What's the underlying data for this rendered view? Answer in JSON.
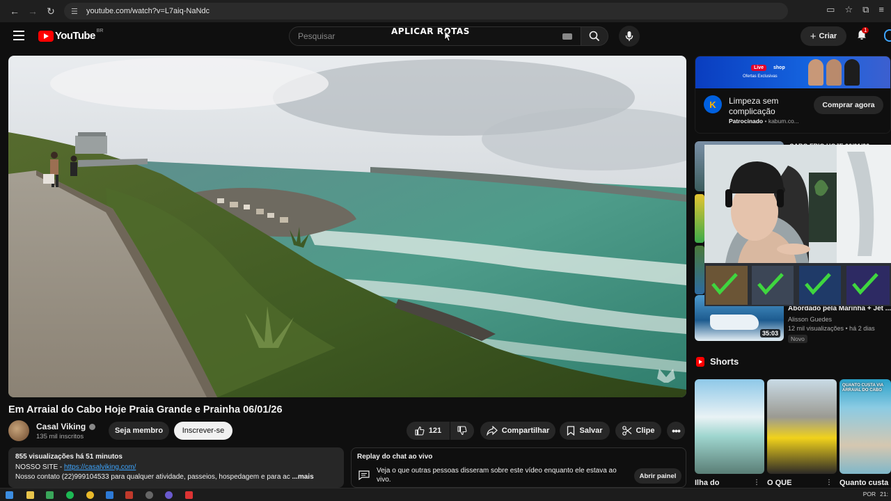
{
  "browser": {
    "url": "youtube.com/watch?v=L7aiq-NaNdc"
  },
  "header": {
    "logo_text": "YouTube",
    "country_code": "BR",
    "search_placeholder": "Pesquisar",
    "overlay_text": "APLICAR ROTAS",
    "create_label": "Criar",
    "notification_count": "1"
  },
  "video": {
    "title": "Em Arraial do Cabo Hoje Praia Grande e Prainha 06/01/26",
    "channel_name": "Casal Viking",
    "subscribers": "135 mil inscritos",
    "member_label": "Seja membro",
    "subscribe_label": "Inscrever-se",
    "likes": "121",
    "share_label": "Compartilhar",
    "save_label": "Salvar",
    "clip_label": "Clipe",
    "watermark": "Casal Viking"
  },
  "description": {
    "meta": "855 visualizações  há 51 minutos",
    "site_prefix": "NOSSO SITE - ",
    "site_link": "https://casalviking.com/",
    "contact": "Nosso contato (22)999104533 para qualquer atividade, passeios, hospedagem e para ac",
    "more": "...mais"
  },
  "chat_replay": {
    "title": "Replay do chat ao vivo",
    "text": "Veja o que outras pessoas disseram sobre este vídeo enquanto ele estava ao vivo.",
    "open_label": "Abrir painel"
  },
  "ad": {
    "live_tag": "Live",
    "shop": "shop",
    "offers": "Ofertas Exclusivas",
    "headline": "Limpeza sem complicação",
    "sponsored": "Patrocinado",
    "advertiser": "kabum.co...",
    "cta": "Comprar agora"
  },
  "recommendations": {
    "top_title": "CABO FRIO HOJE 06/01/26",
    "video_title": "Abordado pela Marinha + Jet ...",
    "video_channel": "Alisson Guedes",
    "video_meta": "12 mil visualizações • há 2 dias",
    "video_badge": "Novo",
    "video_duration": "35:03"
  },
  "shorts": {
    "header": "Shorts",
    "items": [
      {
        "label": "Ilha do"
      },
      {
        "label": "O QUE"
      },
      {
        "label": "Quanto custa",
        "overlay": "QUANTO CUSTA VIA ARRAIAL DO CABO"
      }
    ]
  },
  "taskbar": {
    "lang": "POR",
    "time": "21:"
  },
  "colors": {
    "youtube_red": "#ff0000",
    "link_blue": "#3ea6ff",
    "background": "#0f0f0f"
  }
}
